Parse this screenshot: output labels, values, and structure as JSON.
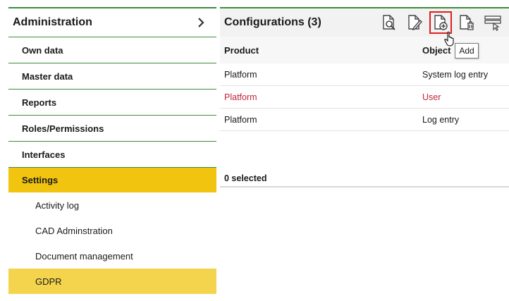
{
  "sidebar": {
    "title": "Administration",
    "items": [
      {
        "label": "Own data"
      },
      {
        "label": "Master data"
      },
      {
        "label": "Reports"
      },
      {
        "label": "Roles/Permissions"
      },
      {
        "label": "Interfaces"
      },
      {
        "label": "Settings",
        "active": true
      }
    ],
    "subitems": [
      {
        "label": "Activity log"
      },
      {
        "label": "CAD Adminstration"
      },
      {
        "label": "Document management"
      },
      {
        "label": "GDPR",
        "active": true
      }
    ]
  },
  "main": {
    "title": "Configurations (3)",
    "toolbar": {
      "buttons": [
        "view-document-icon",
        "edit-document-icon",
        "add-document-icon",
        "delete-document-icon",
        "select-rows-icon"
      ],
      "tooltip": "Add"
    },
    "columns": [
      "Product",
      "Object"
    ],
    "rows": [
      {
        "product": "Platform",
        "object": "System log entry"
      },
      {
        "product": "Platform",
        "object": "User",
        "highlight": true
      },
      {
        "product": "Platform",
        "object": "Log entry"
      }
    ],
    "footer": "0 selected"
  },
  "colors": {
    "accent_green": "#3c8c3c",
    "active_yellow": "#f1c40f",
    "sub_active_yellow": "#f4d44d",
    "highlight_red": "#c0273a",
    "focus_outline": "#e01e1e"
  }
}
